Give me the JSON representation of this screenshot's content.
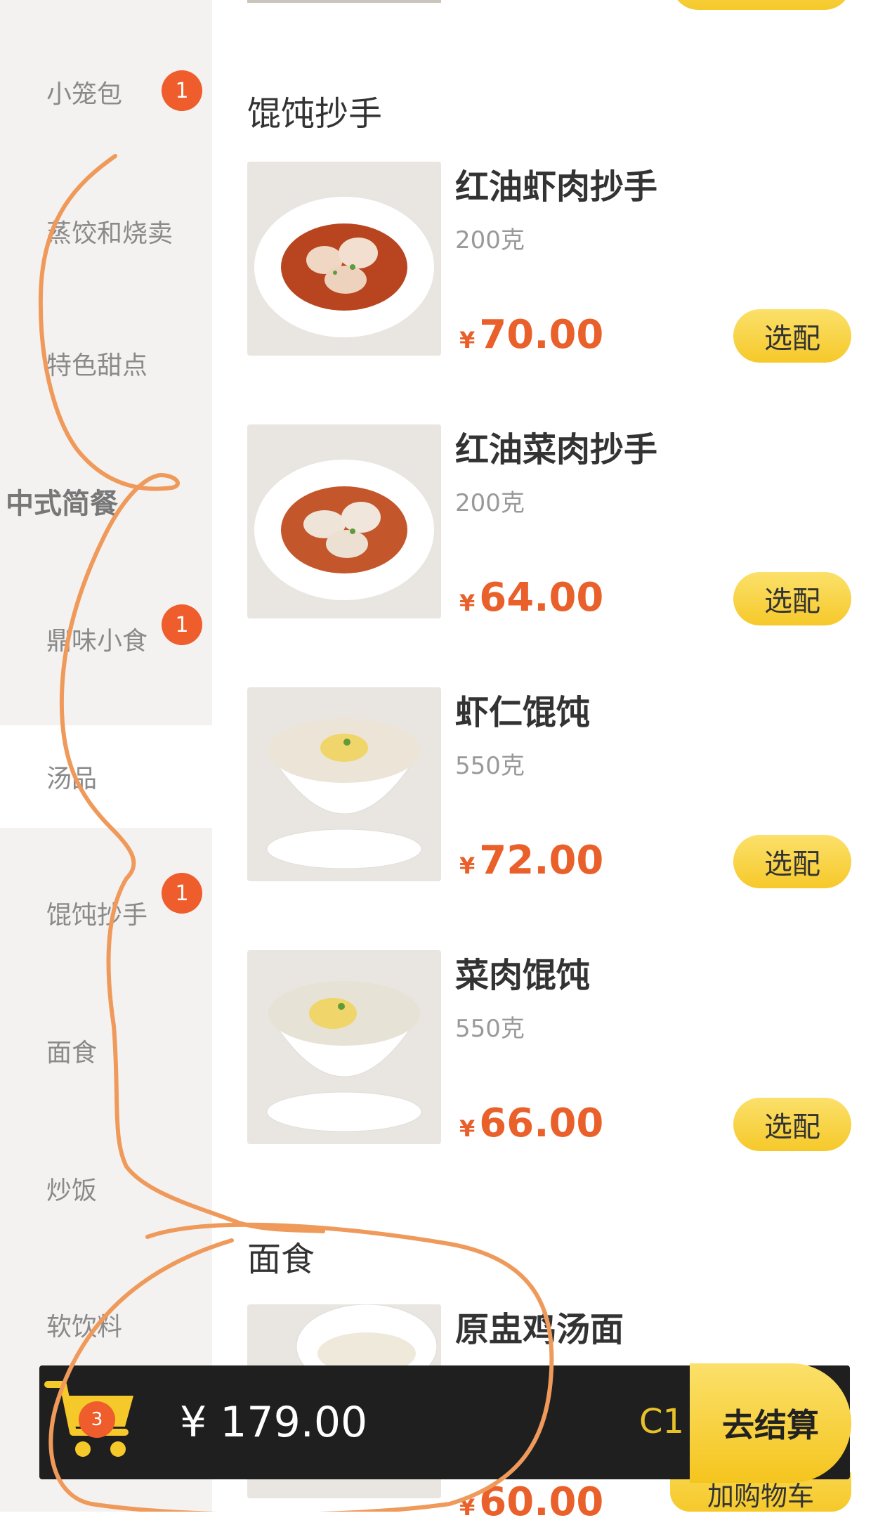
{
  "sidebar": {
    "categories": [
      {
        "label": "小笼包",
        "badge": "1"
      },
      {
        "label": "蒸饺和烧卖"
      },
      {
        "label": "特色甜点"
      },
      {
        "label": "中式简餐"
      },
      {
        "label": "鼎味小食",
        "badge": "1"
      },
      {
        "label": "汤品"
      },
      {
        "label": "馄饨抄手",
        "badge": "1"
      },
      {
        "label": "面食"
      },
      {
        "label": "炒饭"
      },
      {
        "label": "软饮料"
      }
    ]
  },
  "main": {
    "sections": [
      {
        "title": "馄饨抄手"
      },
      {
        "title": "面食"
      }
    ],
    "items": [
      {
        "name": "红油虾肉抄手",
        "weight": "200克",
        "currency": "¥",
        "price": "70.00",
        "button": "选配"
      },
      {
        "name": "红油菜肉抄手",
        "weight": "200克",
        "currency": "¥",
        "price": "64.00",
        "button": "选配"
      },
      {
        "name": "虾仁馄饨",
        "weight": "550克",
        "currency": "¥",
        "price": "72.00",
        "button": "选配"
      },
      {
        "name": "菜肉馄饨",
        "weight": "550克",
        "currency": "¥",
        "price": "66.00",
        "button": "选配"
      },
      {
        "name": "原盅鸡汤面",
        "currency": "¥",
        "price": "60.00",
        "button": "加购物车"
      }
    ]
  },
  "cart": {
    "count": "3",
    "total": "¥ 179.00",
    "table_code": "C1",
    "checkout_label": "去结算"
  },
  "colors": {
    "accent_orange": "#e9602b",
    "badge_red": "#ee5d2b",
    "button_yellow": "#f6c92a",
    "annotation_stroke": "#ef9a5a"
  }
}
